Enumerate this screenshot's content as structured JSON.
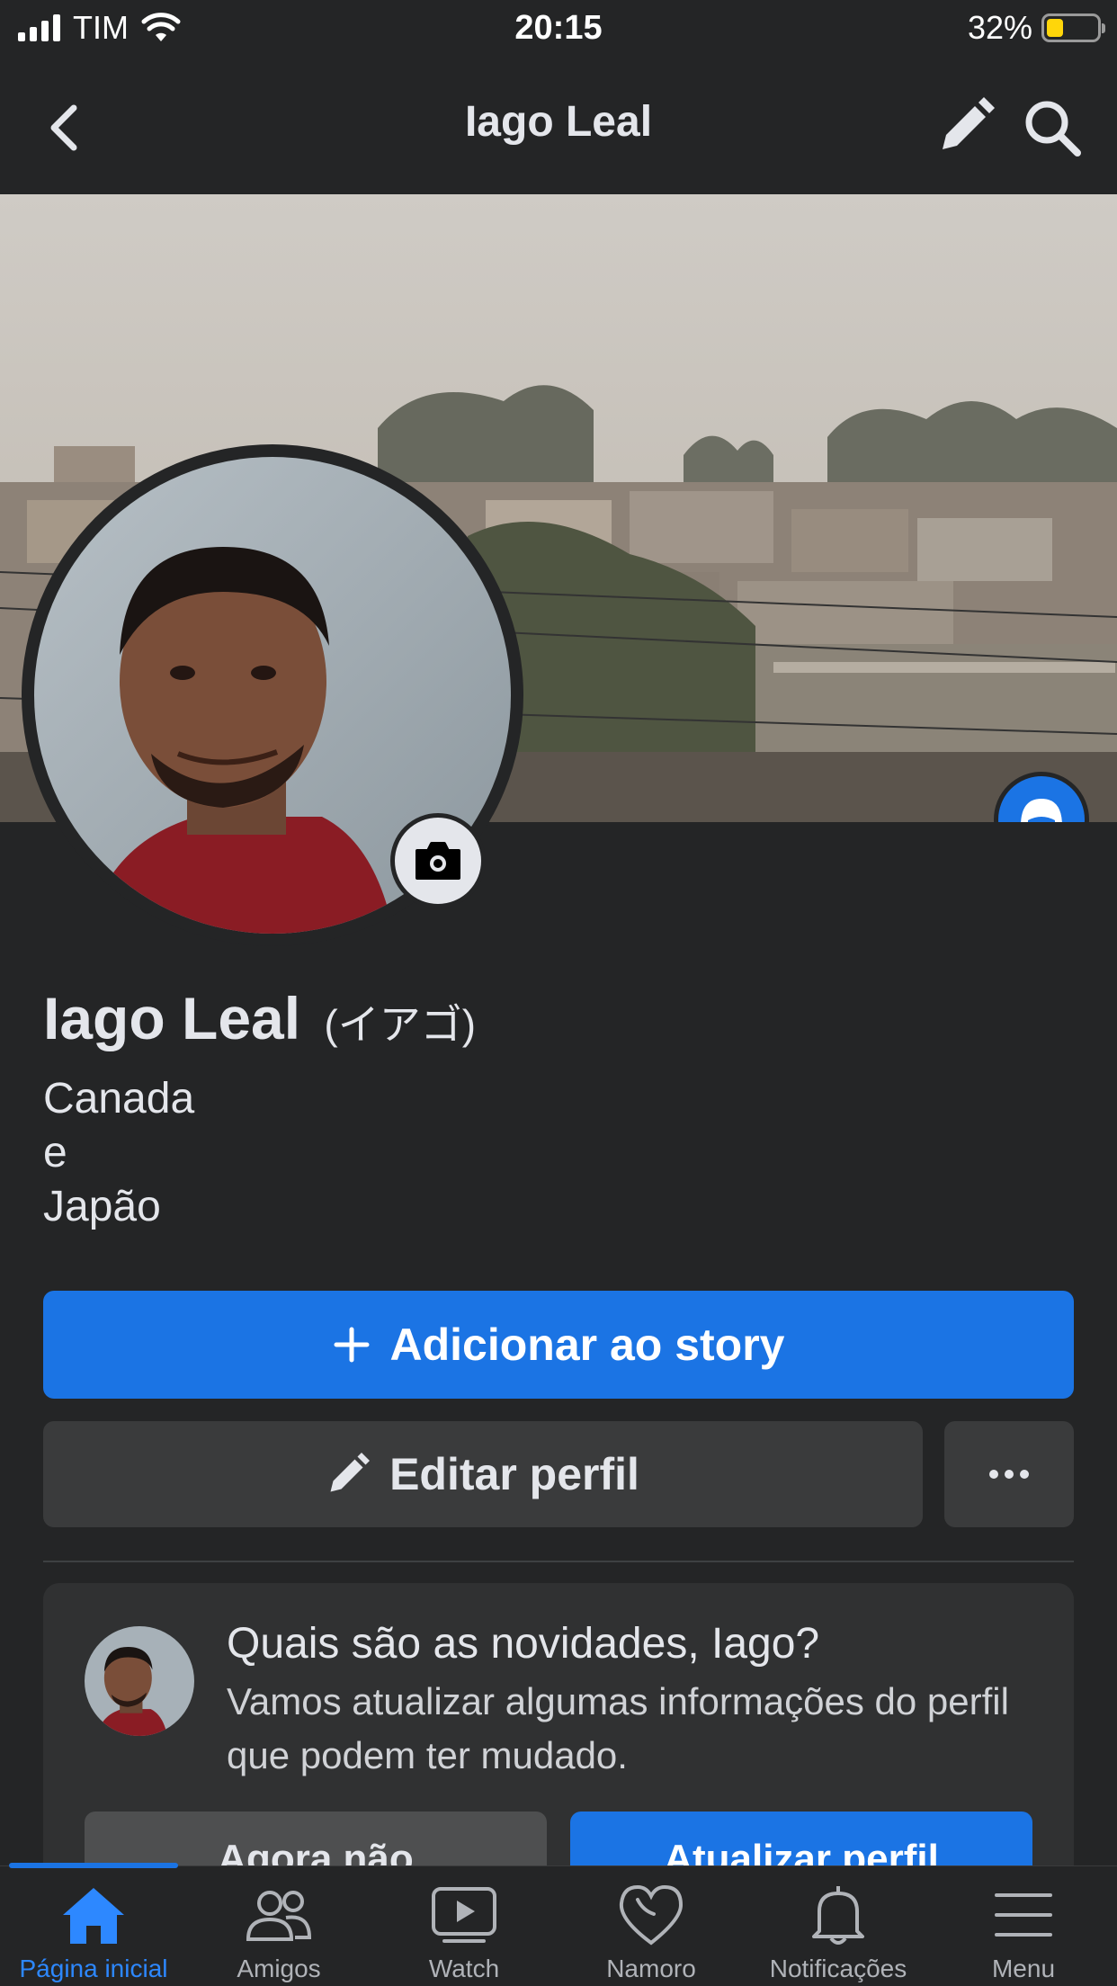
{
  "status_bar": {
    "carrier": "TIM",
    "time": "20:15",
    "battery": "32%",
    "battery_level": 0.32
  },
  "header": {
    "title": "Iago Leal",
    "back_icon": "chevron-left-icon",
    "edit_icon": "pencil-icon",
    "search_icon": "search-icon"
  },
  "profile": {
    "name": "Iago Leal",
    "alternate_name": "(イアゴ)",
    "bio_lines": [
      "Canada",
      "e",
      "Japão"
    ]
  },
  "actions": {
    "add_story": "Adicionar ao story",
    "edit_profile": "Editar perfil"
  },
  "prompt_card": {
    "title": "Quais são as novidades, Iago?",
    "text": "Vamos atualizar algumas informações do perfil que podem ter mudado.",
    "not_now": "Agora não",
    "update": "Atualizar perfil"
  },
  "tabs": [
    {
      "label": "Página inicial",
      "icon": "home-icon",
      "active": true
    },
    {
      "label": "Amigos",
      "icon": "friends-icon",
      "active": false
    },
    {
      "label": "Watch",
      "icon": "watch-icon",
      "active": false
    },
    {
      "label": "Namoro",
      "icon": "heart-icon",
      "active": false
    },
    {
      "label": "Notificações",
      "icon": "bell-icon",
      "active": false
    },
    {
      "label": "Menu",
      "icon": "menu-icon",
      "active": false
    }
  ],
  "colors": {
    "background": "#242526",
    "accent": "#1b74e4",
    "secondary_button": "#3a3b3c",
    "text": "#e4e6eb"
  }
}
